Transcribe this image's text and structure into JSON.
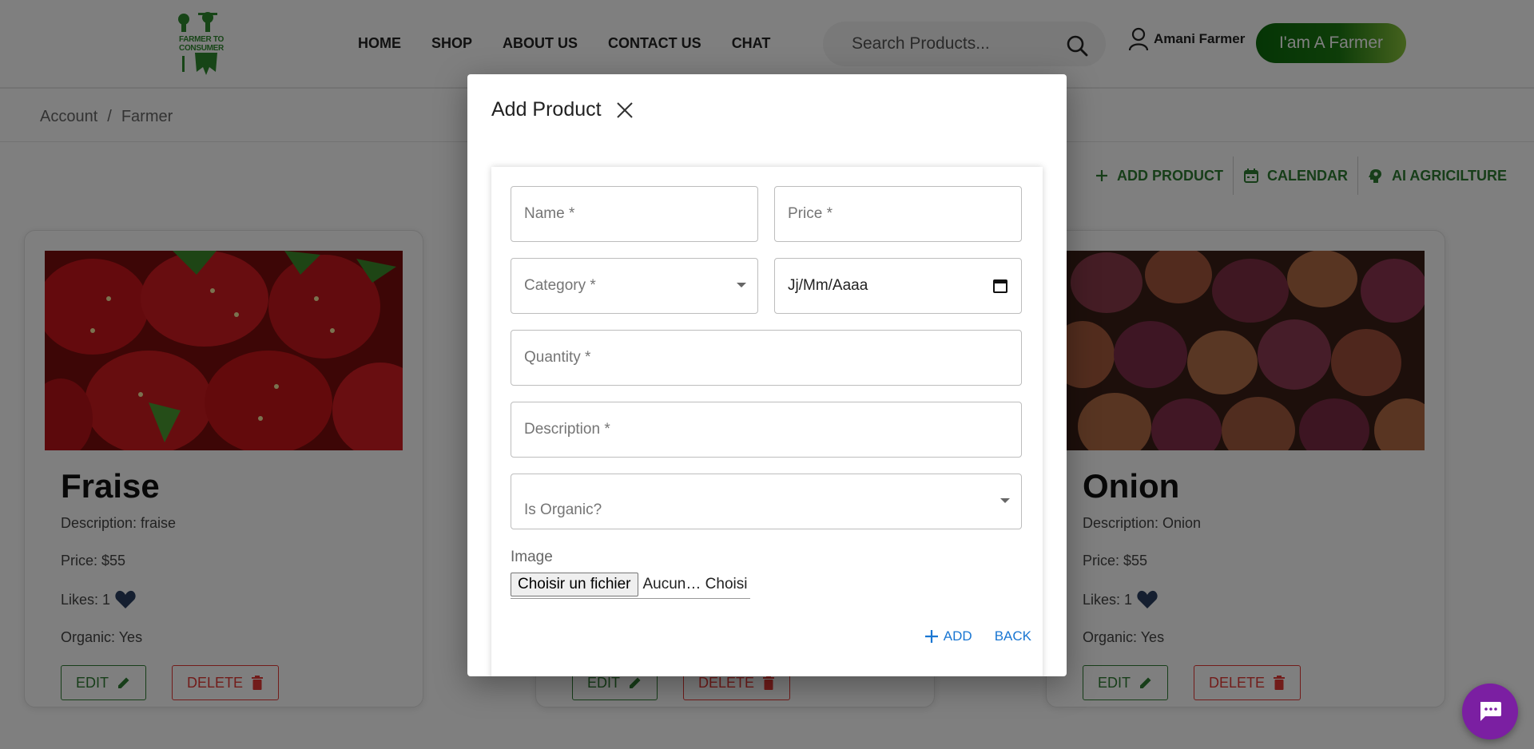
{
  "header": {
    "logo_text": "FARMER TO CONSUMER",
    "nav": [
      "HOME",
      "SHOP",
      "ABOUT US",
      "CONTACT US",
      "CHAT"
    ],
    "search_placeholder": "Search Products...",
    "user_name": "Amani Farmer",
    "farmer_button": "I'am A Farmer"
  },
  "breadcrumb": [
    "Account",
    "/",
    "Farmer"
  ],
  "actions": [
    "ADD PRODUCT",
    "CALENDAR",
    "AI AGRICILTURE"
  ],
  "cards": [
    {
      "title": "Fraise",
      "description": "Description: fraise",
      "price": "Price: $55",
      "likes": "Likes: 1",
      "organic": "Organic: Yes",
      "edit": "EDIT",
      "delete": "DELETE"
    },
    {
      "title": "",
      "description": "",
      "price": "",
      "likes": "",
      "organic": "",
      "edit": "EDIT",
      "delete": "DELETE"
    },
    {
      "title": "Onion",
      "description": "Description: Onion",
      "price": "Price: $55",
      "likes": "Likes: 1",
      "organic": "Organic: Yes",
      "edit": "EDIT",
      "delete": "DELETE"
    }
  ],
  "modal": {
    "title": "Add Product",
    "name_placeholder": "Name *",
    "price_placeholder": "Price *",
    "category_placeholder": "Category *",
    "date_value": "Jj/Mm/Aaaa",
    "quantity_placeholder": "Quantity *",
    "description_placeholder": "Description *",
    "organic_placeholder": "Is Organic?",
    "image_label": "Image",
    "file_button": "Choisir un fichier",
    "file_status": "Aucun… Choisi",
    "add_label": "ADD",
    "back_label": "BACK"
  },
  "colors": {
    "primary_green": "#2e7d32",
    "delete_red": "#e53935",
    "link_blue": "#1976d2",
    "chat_purple": "#7b1fa2"
  }
}
